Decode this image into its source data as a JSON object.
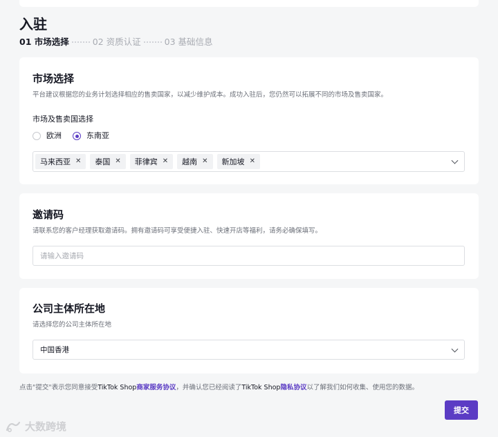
{
  "page": {
    "title": "入驻"
  },
  "steps": [
    {
      "label": "01 市场选择",
      "active": true
    },
    {
      "label": "02 资质认证",
      "active": false
    },
    {
      "label": "03 基础信息",
      "active": false
    }
  ],
  "market": {
    "title": "市场选择",
    "description": "平台建议根据您的业务计划选择相应的售卖国家，以减少维护成本。成功入驻后，您仍然可以拓展不同的市场及售卖国家。",
    "field_label": "市场及售卖国选择",
    "regions": [
      {
        "label": "欧洲",
        "checked": false
      },
      {
        "label": "东南亚",
        "checked": true
      }
    ],
    "countries": [
      "马来西亚",
      "泰国",
      "菲律宾",
      "越南",
      "新加坡"
    ]
  },
  "invite": {
    "title": "邀请码",
    "description": "请联系您的客户经理获取邀请码。拥有邀请码可享受便捷入驻、快速开店等福利，请务必确保填写。",
    "placeholder": "请输入邀请码",
    "value": ""
  },
  "company": {
    "title": "公司主体所在地",
    "description": "请选择您的公司主体所在地",
    "selected": "中国香港"
  },
  "agreement": {
    "prefix": "点击\"提交\"表示您同意接受",
    "brand1": "TikTok Shop",
    "link1": "商家服务协议",
    "middle": "，并确认您已经阅读了",
    "brand2": "TikTok Shop",
    "link2": "隐私协议",
    "suffix": "以了解我们如何收集、使用您的数据。"
  },
  "submit_label": "提交",
  "watermark": "大数跨境",
  "colors": {
    "accent": "#5b3cc4",
    "background": "#f5f6f7"
  }
}
